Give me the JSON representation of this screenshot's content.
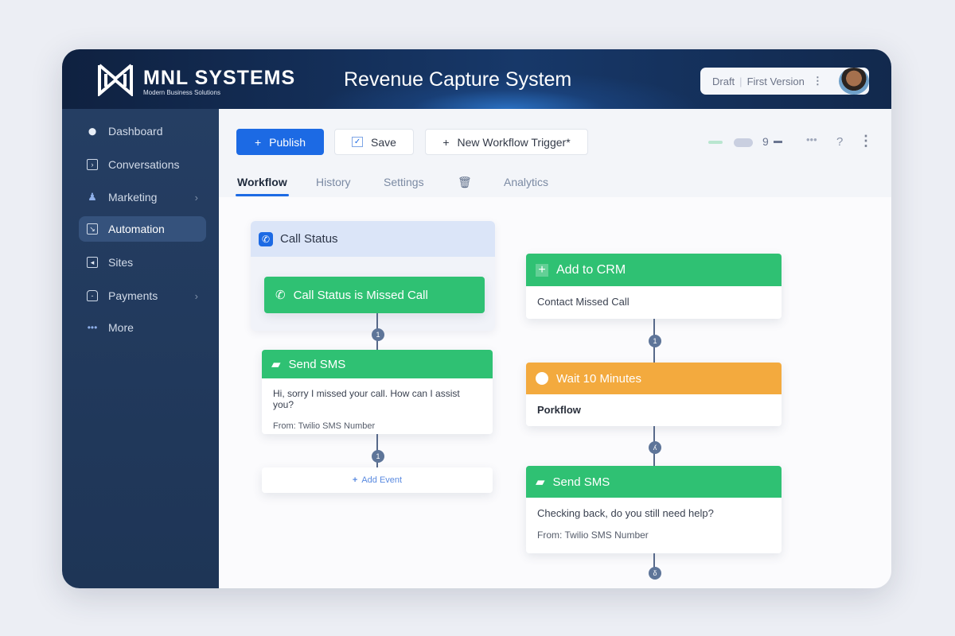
{
  "header": {
    "brand": "MNL SYSTEMS",
    "tagline": "Modern Business Solutions",
    "title": "Revenue Capture System",
    "status": "Draft",
    "version": "First Version"
  },
  "sidebar": {
    "items": [
      {
        "label": "Dashboard"
      },
      {
        "label": "Conversations"
      },
      {
        "label": "Marketing"
      },
      {
        "label": "Automation"
      },
      {
        "label": "Sites"
      },
      {
        "label": "Payments"
      },
      {
        "label": "More"
      }
    ]
  },
  "toolbar": {
    "publish": "Publish",
    "save": "Save",
    "new_trigger": "New Workflow Trigger*",
    "zoom_value": "9",
    "help": "?"
  },
  "tabs": [
    "Workflow",
    "History",
    "Settings",
    "Analytics"
  ],
  "workflow": {
    "trigger_group": "Call Status",
    "trigger": "Call Status is Missed Call",
    "sms1": {
      "title": "Send SMS",
      "message": "Hi, sorry I missed your call. How can I assist you?",
      "from": "From: Twilio SMS Number"
    },
    "add_event": "Add Event",
    "crm": {
      "title": "Add to CRM",
      "body": "Contact Missed Call"
    },
    "wait": {
      "title": "Wait 10 Minutes",
      "body": "Porkflow"
    },
    "sms2": {
      "title": "Send SMS",
      "message": "Checking back, do you still need help?",
      "from": "From: Twilio SMS Number"
    },
    "connectors": [
      "1",
      "1",
      "1",
      "ʎ",
      "δ"
    ]
  },
  "colors": {
    "accent": "#1c6ae4",
    "green": "#2fc173",
    "orange": "#f3aa3e",
    "navy": "#1e3556"
  }
}
